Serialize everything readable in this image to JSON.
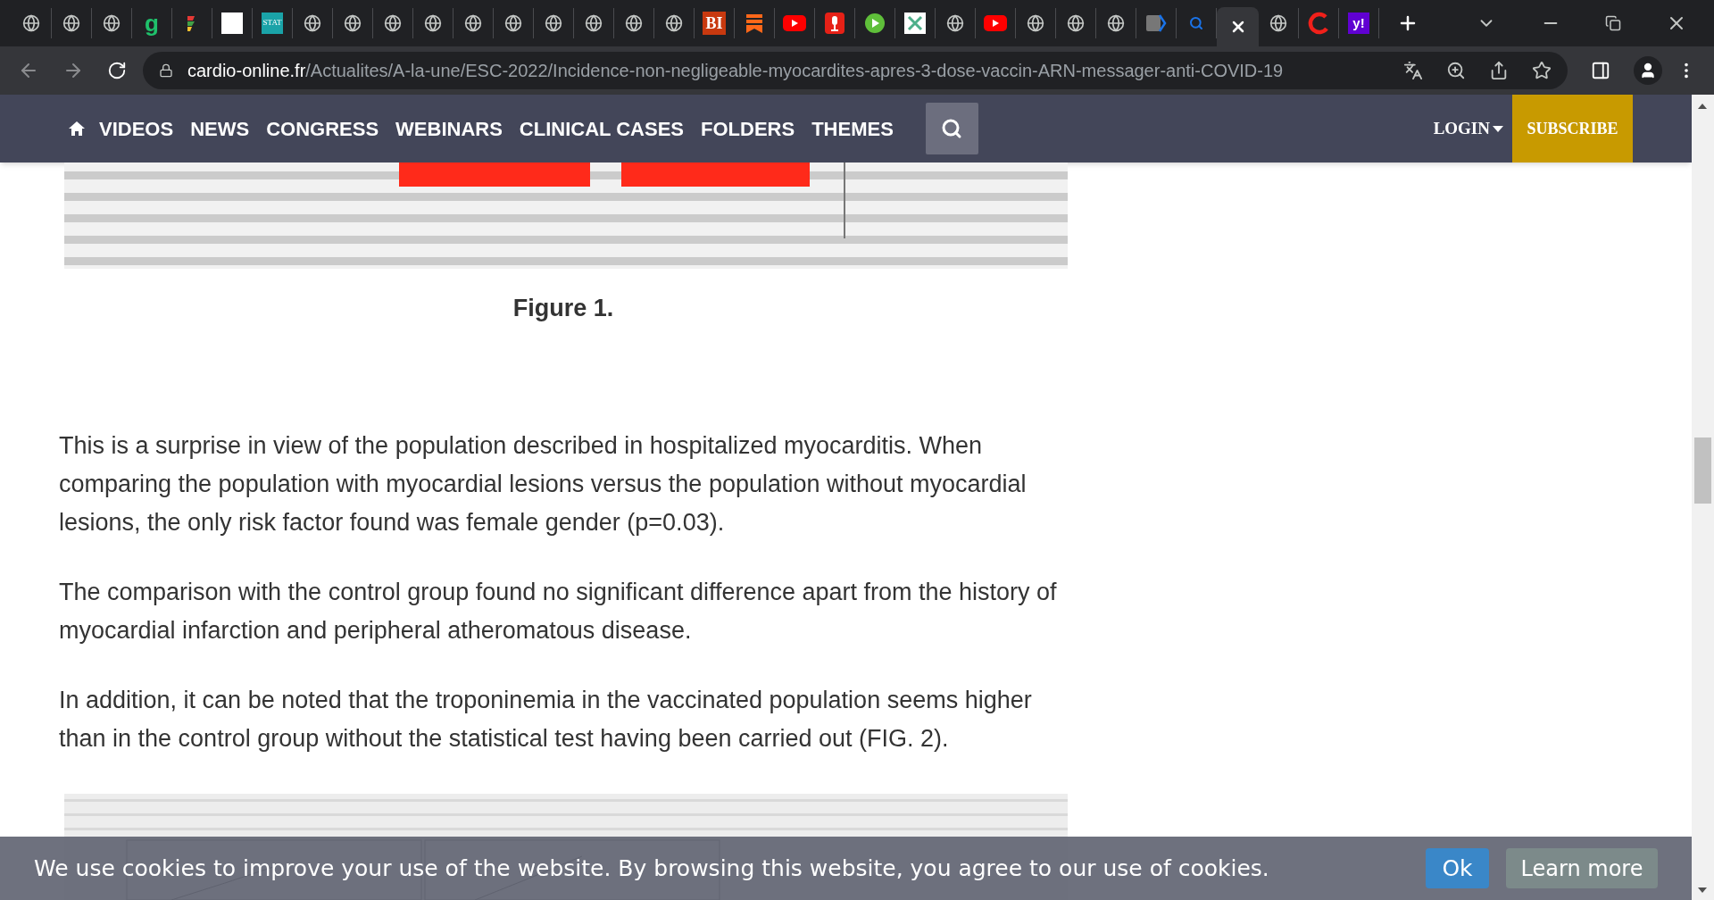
{
  "browser": {
    "tabs": [
      {
        "kind": "globe",
        "selected": false
      },
      {
        "kind": "globe",
        "selected": false
      },
      {
        "kind": "globe",
        "selected": false
      },
      {
        "kind": "letter",
        "label": "g",
        "selected": false
      },
      {
        "kind": "flag",
        "selected": false
      },
      {
        "kind": "white",
        "selected": false
      },
      {
        "kind": "stat",
        "label": "STAT",
        "selected": false
      },
      {
        "kind": "globe",
        "selected": false
      },
      {
        "kind": "globe",
        "selected": false
      },
      {
        "kind": "globe",
        "selected": false
      },
      {
        "kind": "globe",
        "selected": false
      },
      {
        "kind": "globe",
        "selected": false
      },
      {
        "kind": "globe",
        "selected": false
      },
      {
        "kind": "globe",
        "selected": false
      },
      {
        "kind": "globe",
        "selected": false
      },
      {
        "kind": "globe",
        "selected": false
      },
      {
        "kind": "globe",
        "selected": false
      },
      {
        "kind": "bi",
        "label": "BI",
        "selected": false
      },
      {
        "kind": "bookmark",
        "selected": false
      },
      {
        "kind": "youtube",
        "selected": false
      },
      {
        "kind": "mic",
        "selected": false
      },
      {
        "kind": "play",
        "selected": false
      },
      {
        "kind": "grid",
        "selected": false
      },
      {
        "kind": "globe",
        "selected": false
      },
      {
        "kind": "youtube",
        "selected": false
      },
      {
        "kind": "globe",
        "selected": false
      },
      {
        "kind": "globe",
        "selected": false
      },
      {
        "kind": "globe",
        "selected": false
      },
      {
        "kind": "chevron",
        "selected": false
      },
      {
        "kind": "search",
        "selected": false
      },
      {
        "kind": "close",
        "selected": true
      },
      {
        "kind": "globe",
        "selected": false
      },
      {
        "kind": "ring",
        "selected": false
      },
      {
        "kind": "yahoo",
        "label": "y!",
        "selected": false
      }
    ],
    "url_domain": "cardio-online.fr",
    "url_path": "/Actualites/A-la-une/ESC-2022/Incidence-non-negligeable-myocardites-apres-3-dose-vaccin-ARN-messager-anti-COVID-19"
  },
  "nav": {
    "items": [
      "VIDEOS",
      "NEWS",
      "CONGRESS",
      "WEBINARS",
      "CLINICAL CASES",
      "FOLDERS",
      "THEMES"
    ],
    "login": "LOGIN",
    "subscribe": "SUBSCRIBE"
  },
  "article": {
    "figure_caption": "Figure 1.",
    "paragraphs": [
      "This is a surprise in view of the population described in hospitalized myocarditis. When comparing the population with myocardial lesions versus the population without myocardial lesions, the only risk factor found was female gender (p=0.03).",
      "The comparison with the control group found no significant difference apart from the history of myocardial infarction and peripheral atheromatous disease.",
      "In addition, it can be noted that the troponinemia in the vaccinated population seems higher than in the control group without the statistical test having been carried out (FIG. 2)."
    ]
  },
  "cookie_bar": {
    "message": "We use cookies to improve your use of the website. By browsing this website, you agree to our use of cookies.",
    "ok": "Ok",
    "learn_more": "Learn more"
  }
}
